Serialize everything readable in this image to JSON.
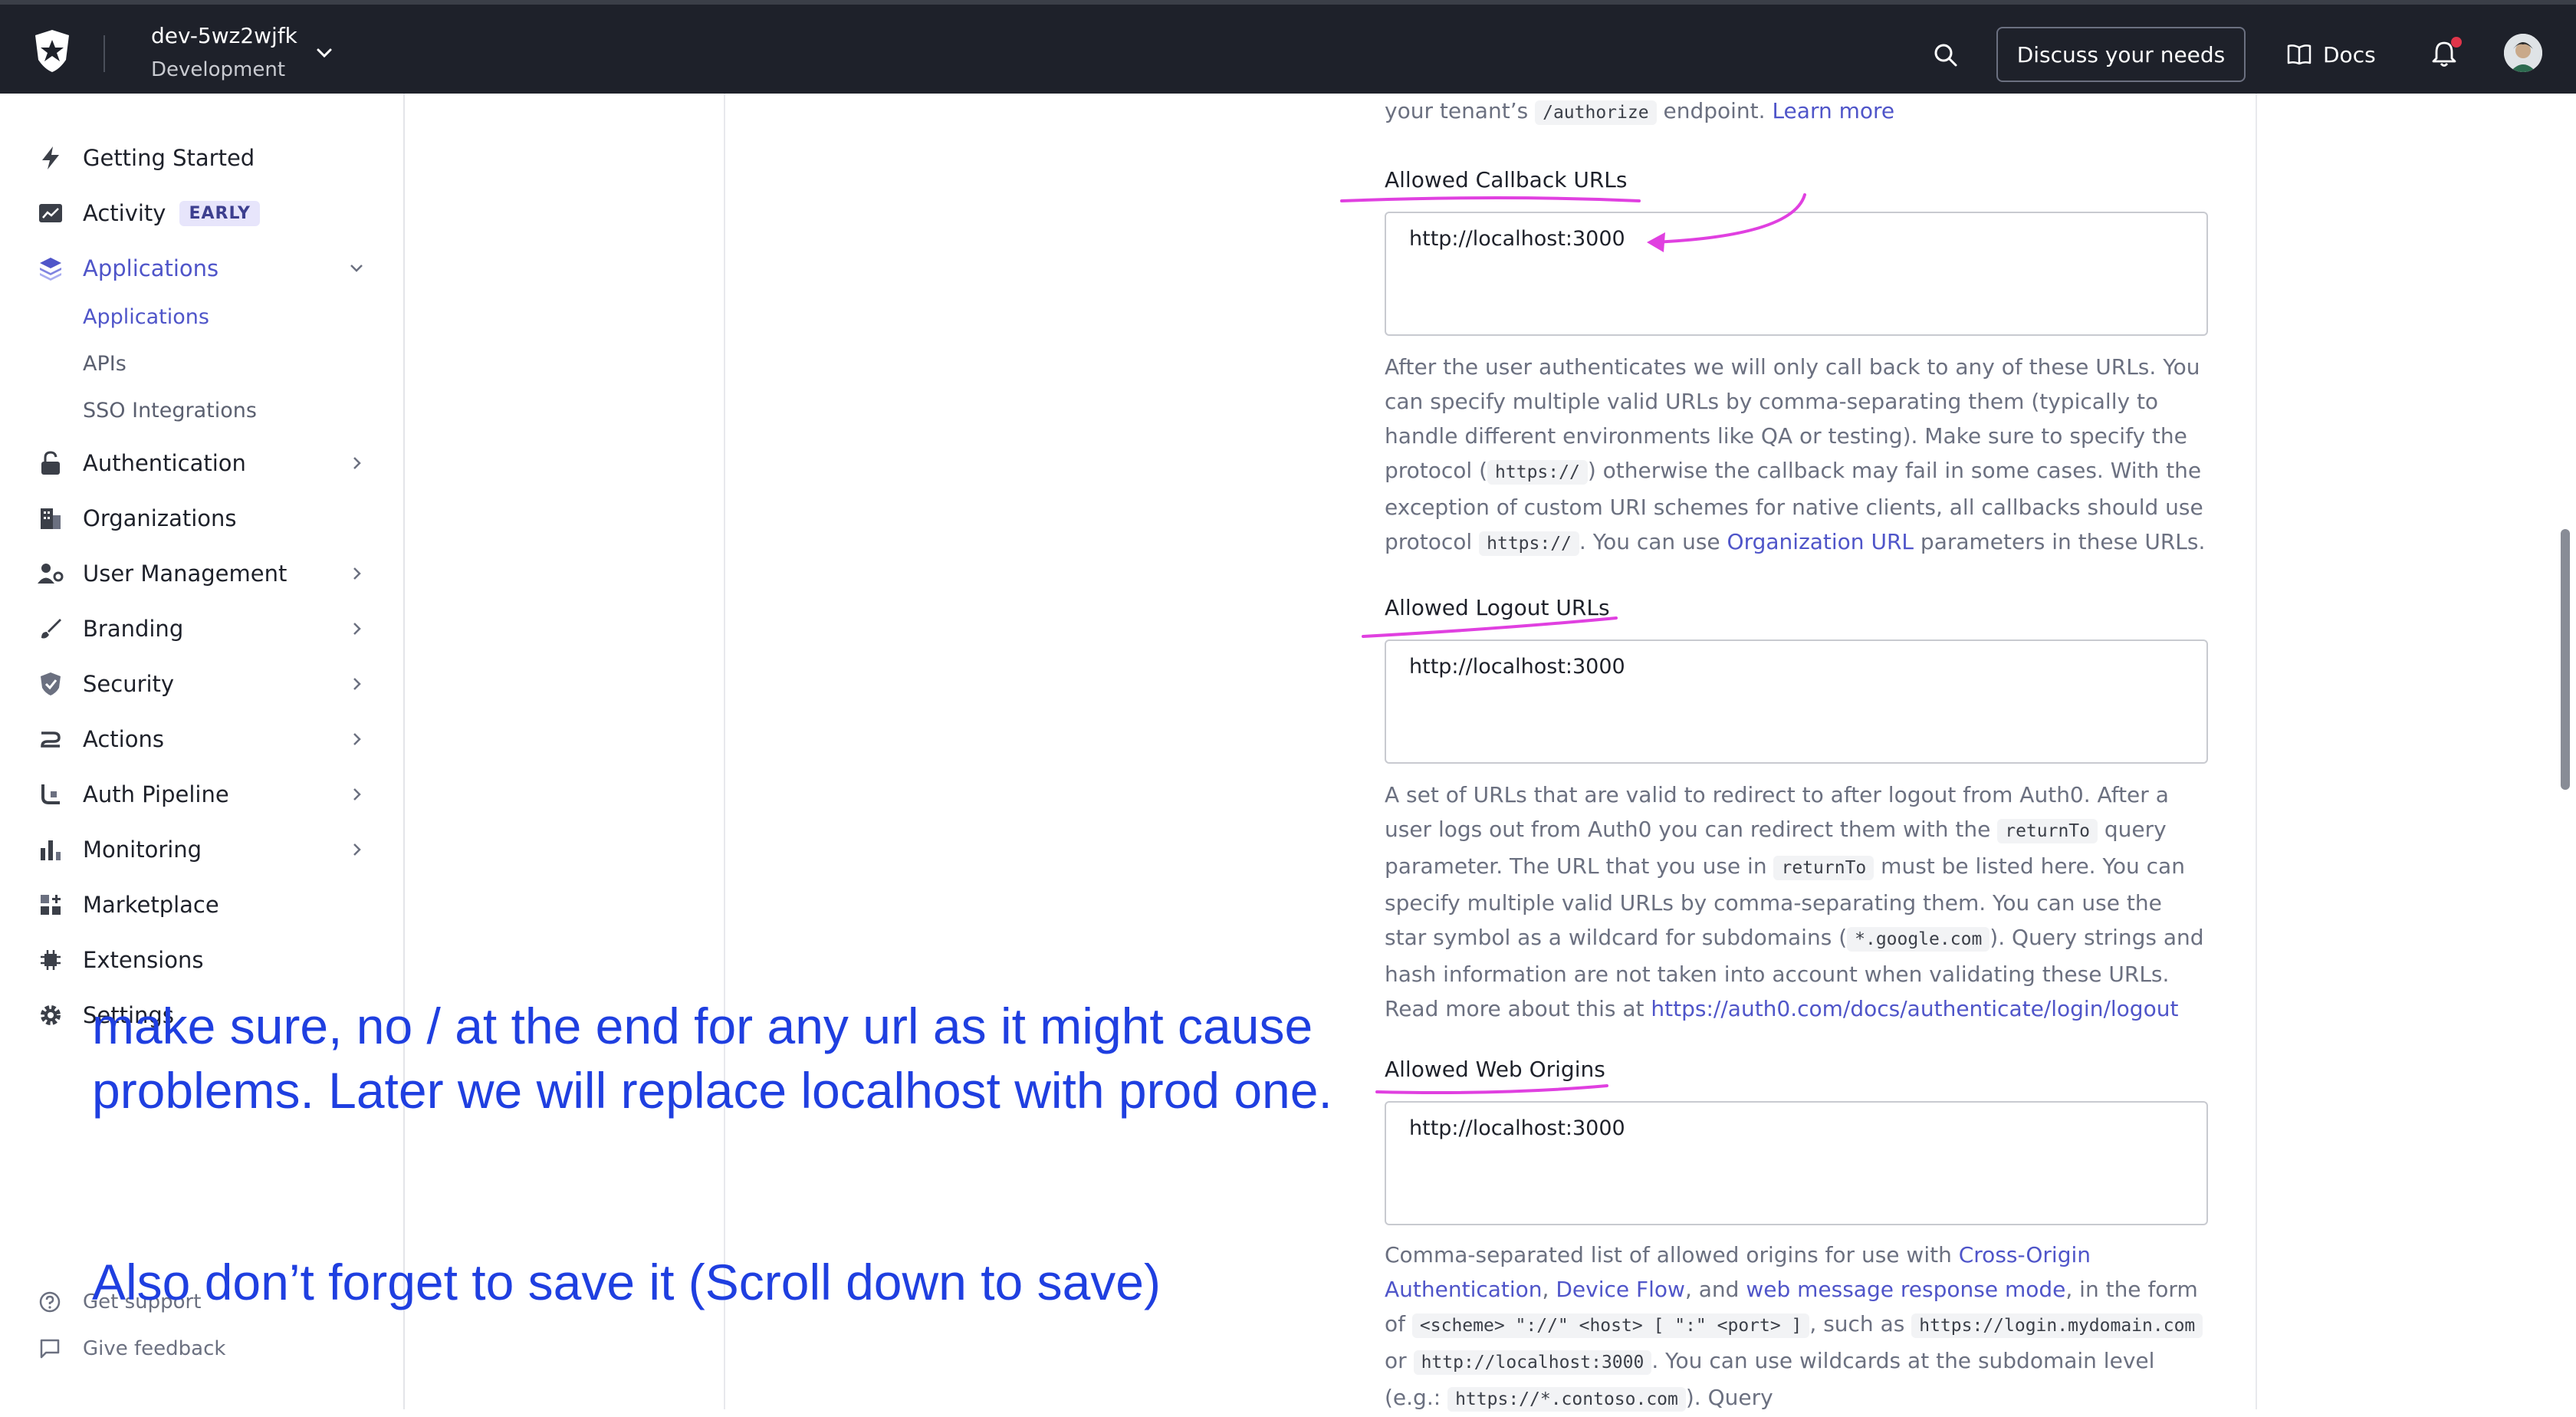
{
  "topbar": {
    "tenant_name": "dev-5wz2wjfk",
    "tenant_env": "Development",
    "discuss_label": "Discuss your needs",
    "docs_label": "Docs",
    "bg_color": "#1e212a"
  },
  "sidebar": {
    "items": [
      {
        "label": "Getting Started",
        "icon": "lightning-icon"
      },
      {
        "label": "Activity",
        "icon": "activity-chart-icon",
        "badge": "EARLY"
      },
      {
        "label": "Applications",
        "icon": "layers-icon",
        "active": true
      },
      {
        "label": "Authentication",
        "icon": "lock-icon"
      },
      {
        "label": "Organizations",
        "icon": "building-icon"
      },
      {
        "label": "User Management",
        "icon": "user-gear-icon"
      },
      {
        "label": "Branding",
        "icon": "brush-icon"
      },
      {
        "label": "Security",
        "icon": "shield-icon"
      },
      {
        "label": "Actions",
        "icon": "actions-icon"
      },
      {
        "label": "Auth Pipeline",
        "icon": "pipeline-icon"
      },
      {
        "label": "Monitoring",
        "icon": "bar-chart-icon"
      },
      {
        "label": "Marketplace",
        "icon": "marketplace-icon"
      },
      {
        "label": "Extensions",
        "icon": "chip-icon"
      },
      {
        "label": "Settings",
        "icon": "gear-icon"
      }
    ],
    "sub_items": [
      "Applications",
      "APIs",
      "SSO Integrations"
    ],
    "footer": {
      "support": "Get support",
      "feedback": "Give feedback"
    }
  },
  "main": {
    "top_help": {
      "prefix": "your tenant’s",
      "code": "/authorize",
      "suffix": "endpoint.",
      "link": "Learn more"
    },
    "callback": {
      "label": "Allowed Callback URLs",
      "value": "http://localhost:3000",
      "help": {
        "t1": "After the user authenticates we will only call back to any of these URLs. You can specify multiple valid URLs by comma-separating them (typically to handle different environments like QA or testing). Make sure to specify the protocol (",
        "c1": "https://",
        "t2": ") otherwise the callback may fail in some cases. With the exception of custom URI schemes for native clients, all callbacks should use protocol",
        "c2": "https://",
        "t3": ". You can use",
        "link": "Organization URL",
        "t4": "parameters in these URLs."
      }
    },
    "logout": {
      "label": "Allowed Logout URLs",
      "value": "http://localhost:3000",
      "help": {
        "t1": "A set of URLs that are valid to redirect to after logout from Auth0. After a user logs out from Auth0 you can redirect them with the",
        "c1": "returnTo",
        "t2": "query parameter. The URL that you use in",
        "c2": "returnTo",
        "t3": "must be listed here. You can specify multiple valid URLs by comma-separating them. You can use the star symbol as a wildcard for subdomains (",
        "c3": "*.google.com",
        "t4": "). Query strings and hash information are not taken into account when validating these URLs. Read more about this at",
        "link": "https://auth0.com/docs/authenticate/login/logout"
      }
    },
    "origins": {
      "label": "Allowed Web Origins",
      "value": "http://localhost:3000",
      "help": {
        "t1": "Comma-separated list of allowed origins for use with",
        "link1": "Cross-Origin Authentication",
        "t2": ",",
        "link2": "Device Flow",
        "t3": ", and",
        "link3": "web message response mode",
        "t4": ", in the form of",
        "c1": "<scheme> \"://\" <host> [ \":\" <port> ]",
        "t5": ", such as",
        "c2": "https://login.mydomain.com",
        "t6": "or",
        "c3": "http://localhost:3000",
        "t7": ". You can use wildcards at the subdomain level (e.g.:",
        "c4": "https://*.contoso.com",
        "t8": "). Query"
      }
    }
  },
  "annotations": {
    "line1": "make sure, no / at the end for any url as it might cause",
    "line2": "problems. Later we will replace localhost with prod one.",
    "line3": "Also don’t forget to save it (Scroll down to save)",
    "color": "#1f3fe0",
    "marker_color": "#e040e0"
  }
}
